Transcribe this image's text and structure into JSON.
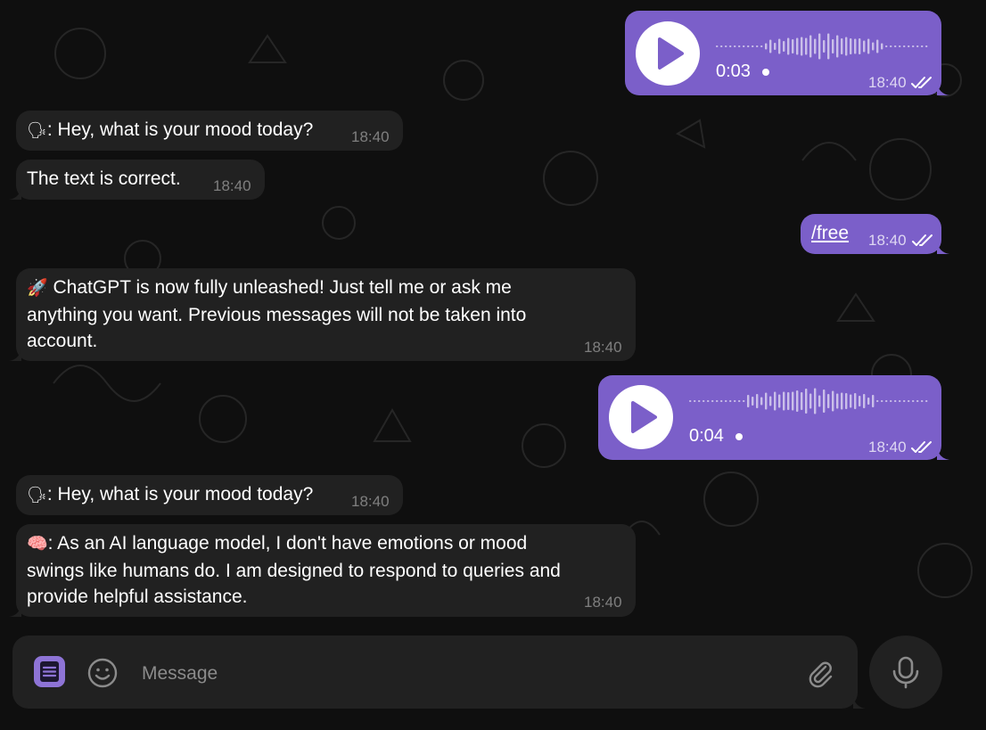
{
  "messages": [
    {
      "id": "voice1",
      "direction": "outgoing",
      "type": "voice",
      "duration": "0:03",
      "time": "18:40"
    },
    {
      "id": "m1",
      "direction": "incoming",
      "emoji": "🗣",
      "text": ": Hey, what is your mood today?",
      "time": "18:40"
    },
    {
      "id": "m2",
      "direction": "incoming",
      "text": "The text is correct.",
      "time": "18:40"
    },
    {
      "id": "m3",
      "direction": "outgoing",
      "text": "/free",
      "time": "18:40"
    },
    {
      "id": "m4",
      "direction": "incoming",
      "emoji": "🚀",
      "lines": [
        " ChatGPT is now fully unleashed! Just tell me or ask me",
        "anything you want. Previous messages will not be taken into",
        "account."
      ],
      "time": "18:40"
    },
    {
      "id": "voice2",
      "direction": "outgoing",
      "type": "voice",
      "duration": "0:04",
      "time": "18:40"
    },
    {
      "id": "m5",
      "direction": "incoming",
      "emoji": "🗣",
      "text": ": Hey, what is your mood today?",
      "time": "18:40"
    },
    {
      "id": "m6",
      "direction": "incoming",
      "emoji": "🧠",
      "lines": [
        ": As an AI language model, I don't have emotions or mood",
        "swings like humans do. I am designed to respond to queries and",
        "provide helpful assistance."
      ],
      "time": "18:40"
    }
  ],
  "composer": {
    "placeholder": "Message"
  },
  "icons": {
    "menu": "menu-icon",
    "emoji": "smile-icon",
    "attach": "paperclip-icon",
    "mic": "microphone-icon",
    "play": "play-icon",
    "read": "double-check-icon"
  },
  "colors": {
    "outgoing_bubble": "#7b5fc9",
    "incoming_bubble": "#212121",
    "background": "#0f0f0f"
  }
}
